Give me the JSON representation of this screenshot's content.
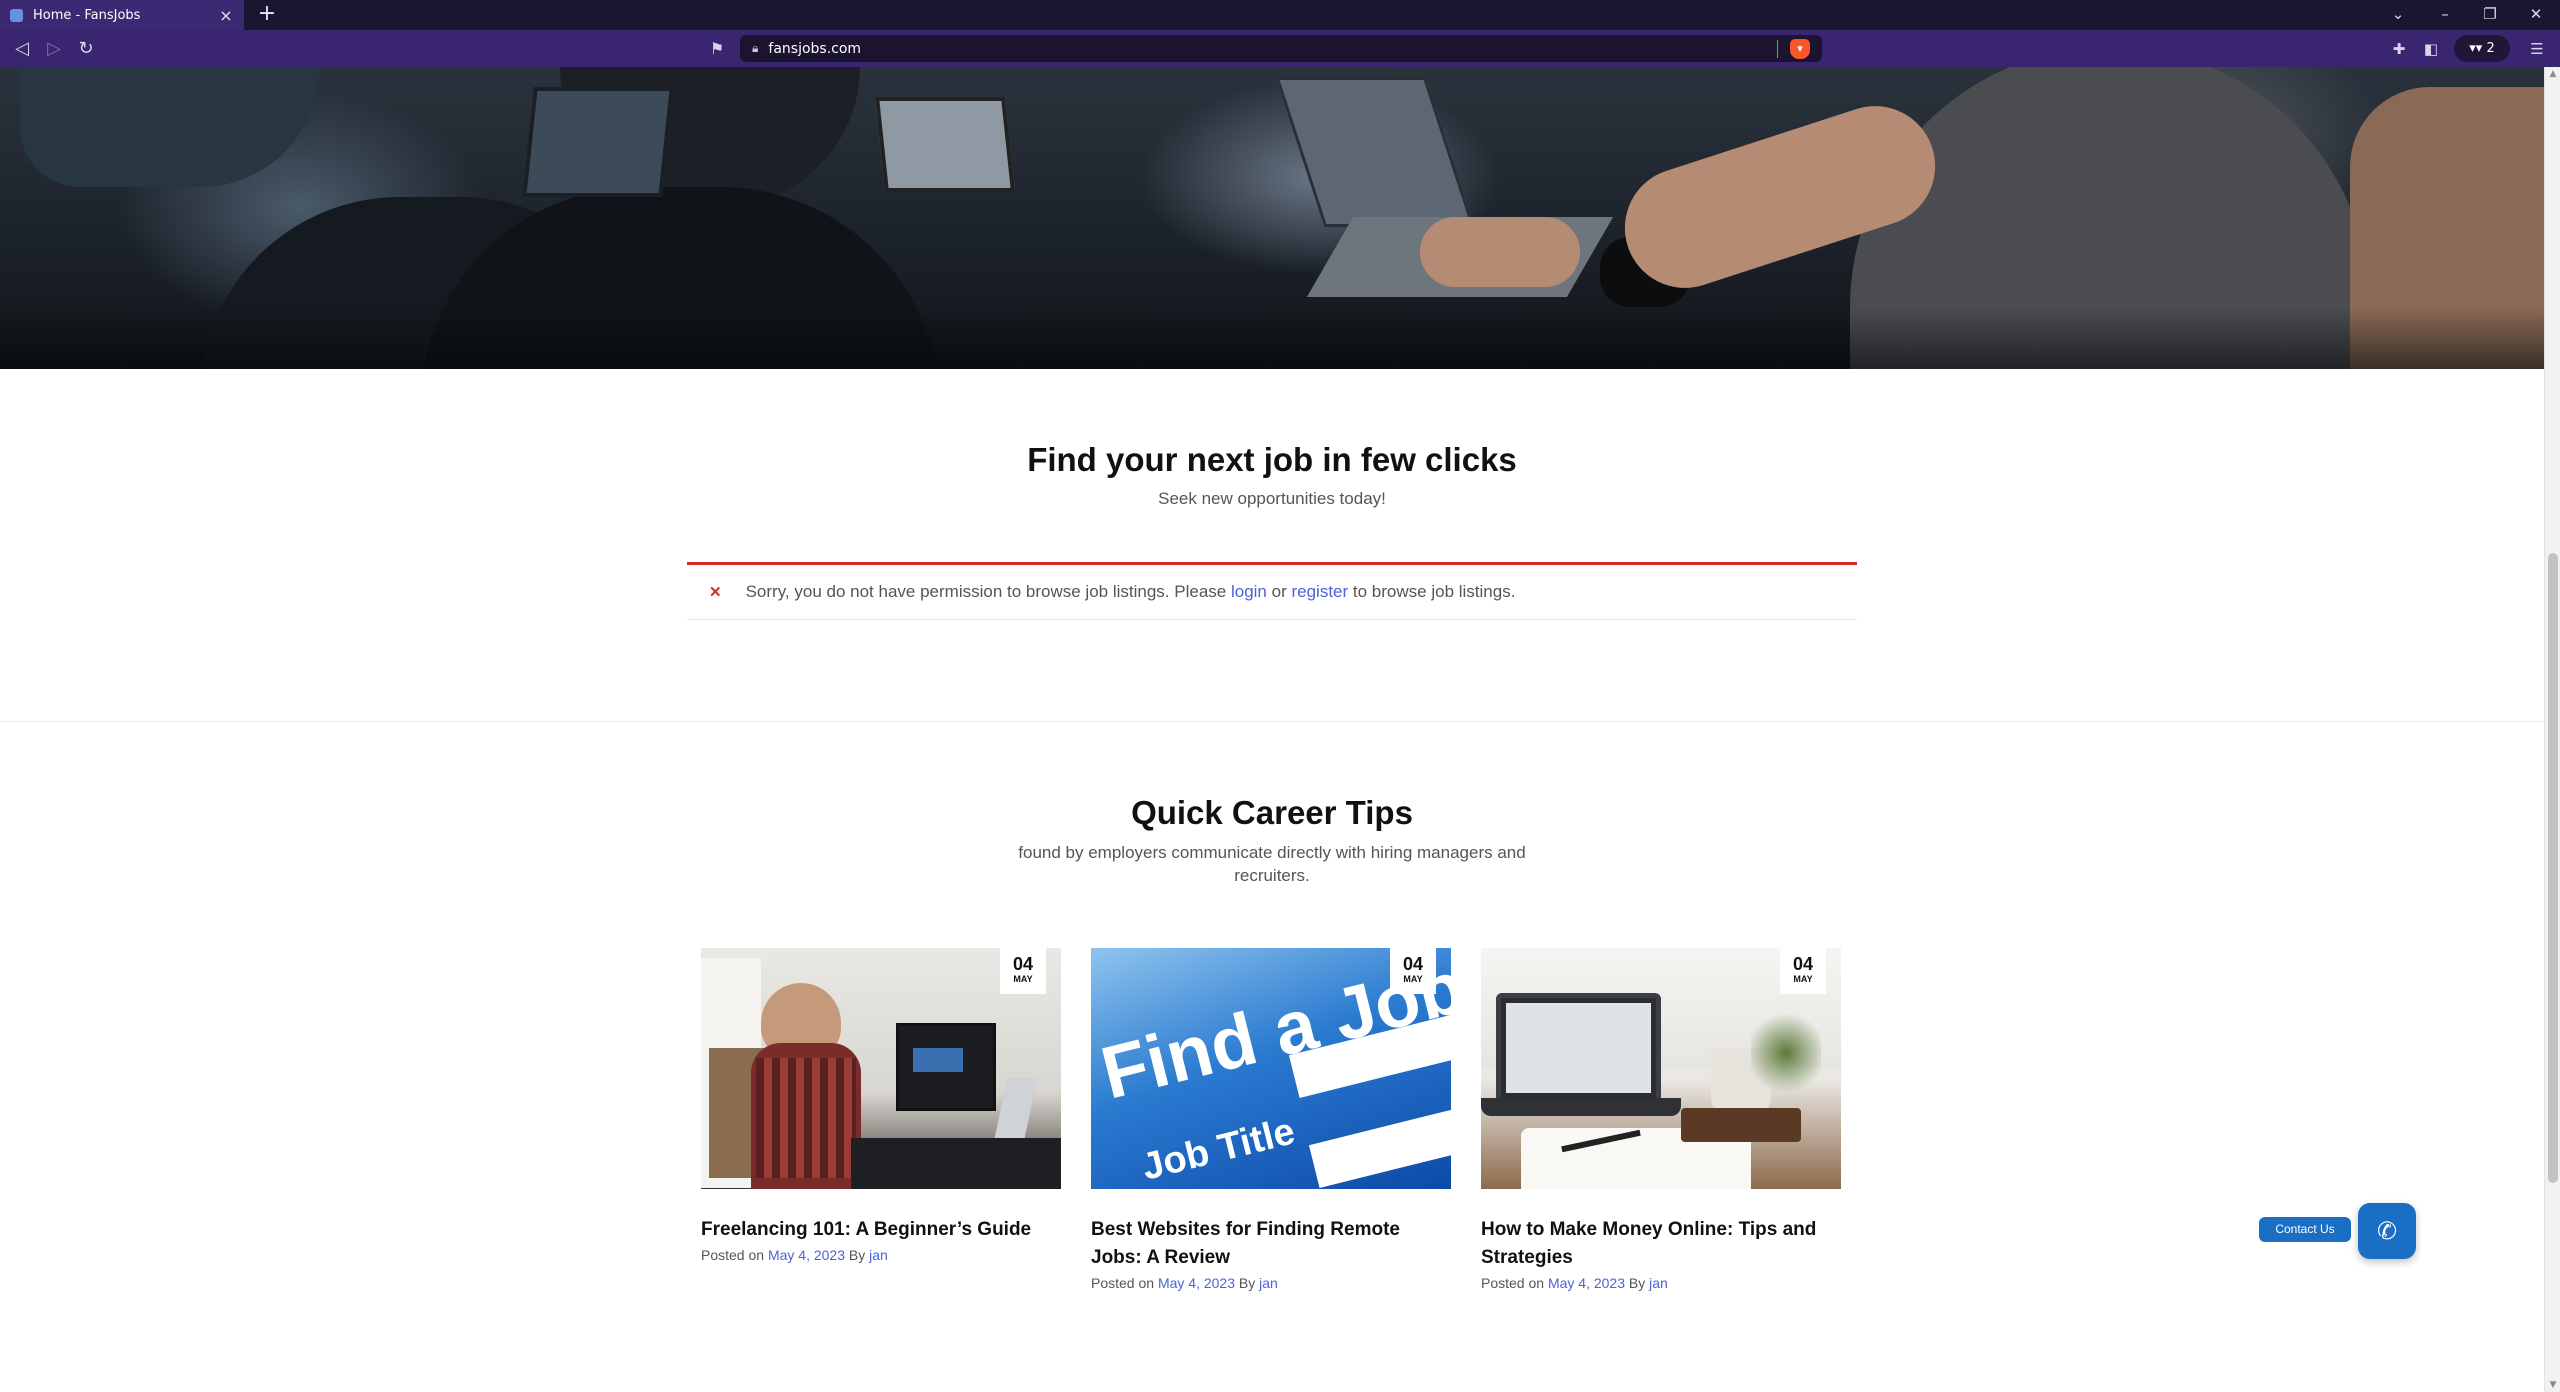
{
  "browser": {
    "tab_title": "Home - FansJobs",
    "new_tab": "+",
    "url": "fansjobs.com",
    "wallet_count": "2",
    "window_controls": [
      "chevron-down-icon",
      "minimize-icon",
      "restore-icon",
      "close-icon"
    ]
  },
  "search_section": {
    "title": "Find your next job in few clicks",
    "subtitle": "Seek new opportunities today!"
  },
  "notice": {
    "prefix": "Sorry, you do not have permission to browse job listings. Please",
    "login_link": "login",
    "or": "or",
    "register_link": "register",
    "suffix": "to browse job listings."
  },
  "tips_section": {
    "title": "Quick Career Tips",
    "subtitle": "found by employers communicate directly with hiring managers and recruiters."
  },
  "posts": [
    {
      "day": "04",
      "month": "MAY",
      "title": "Freelancing 101: A Beginner’s Guide",
      "posted_on": "Posted on",
      "date": "May 4, 2023",
      "by": "By",
      "author": "jan"
    },
    {
      "day": "04",
      "month": "MAY",
      "title": "Best Websites for Finding Remote Jobs: A Review",
      "posted_on": "Posted on",
      "date": "May 4, 2023",
      "by": "By",
      "author": "jan",
      "image_text_1": "Find a Job",
      "image_text_2": "Job Title"
    },
    {
      "day": "04",
      "month": "MAY",
      "title": "How to Make Money Online: Tips and Strategies",
      "posted_on": "Posted on",
      "date": "May 4, 2023",
      "by": "By",
      "author": "jan"
    }
  ],
  "contact": {
    "label": "Contact Us",
    "icon": "phone-icon"
  },
  "colors": {
    "accent_link": "#4b63d6",
    "error_border": "#d42a2a",
    "contact_blue": "#1a6ec4",
    "browser_toolbar": "#3a2670"
  }
}
